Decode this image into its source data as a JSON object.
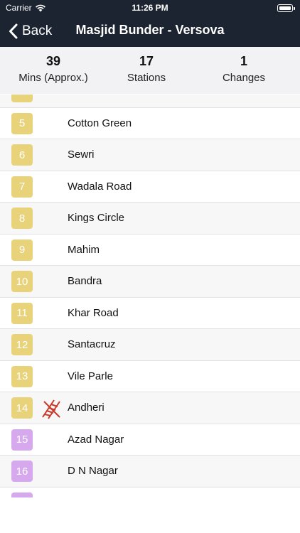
{
  "status_bar": {
    "carrier": "Carrier",
    "time": "11:26 PM"
  },
  "nav": {
    "back_label": "Back",
    "title": "Masjid Bunder - Versova"
  },
  "summary": [
    {
      "value": "39",
      "label": "Mins (Approx.)"
    },
    {
      "value": "17",
      "label": "Stations"
    },
    {
      "value": "1",
      "label": "Changes"
    }
  ],
  "colors": {
    "nav_bg": "#1c2431",
    "line_yellow": "#e8d27a",
    "line_purple": "#d6a8ee"
  },
  "stations": [
    {
      "number": "",
      "name": "",
      "line": "yellow"
    },
    {
      "number": "5",
      "name": "Cotton Green",
      "line": "yellow"
    },
    {
      "number": "6",
      "name": "Sewri",
      "line": "yellow"
    },
    {
      "number": "7",
      "name": "Wadala Road",
      "line": "yellow"
    },
    {
      "number": "8",
      "name": "Kings Circle",
      "line": "yellow"
    },
    {
      "number": "9",
      "name": "Mahim",
      "line": "yellow"
    },
    {
      "number": "10",
      "name": "Bandra",
      "line": "yellow"
    },
    {
      "number": "11",
      "name": "Khar Road",
      "line": "yellow"
    },
    {
      "number": "12",
      "name": "Santacruz",
      "line": "yellow"
    },
    {
      "number": "13",
      "name": "Vile Parle",
      "line": "yellow"
    },
    {
      "number": "14",
      "name": "Andheri",
      "line": "yellow",
      "interchange": true
    },
    {
      "number": "15",
      "name": "Azad Nagar",
      "line": "purple"
    },
    {
      "number": "16",
      "name": "D N Nagar",
      "line": "purple"
    },
    {
      "number": "",
      "name": "",
      "line": "purple"
    }
  ]
}
